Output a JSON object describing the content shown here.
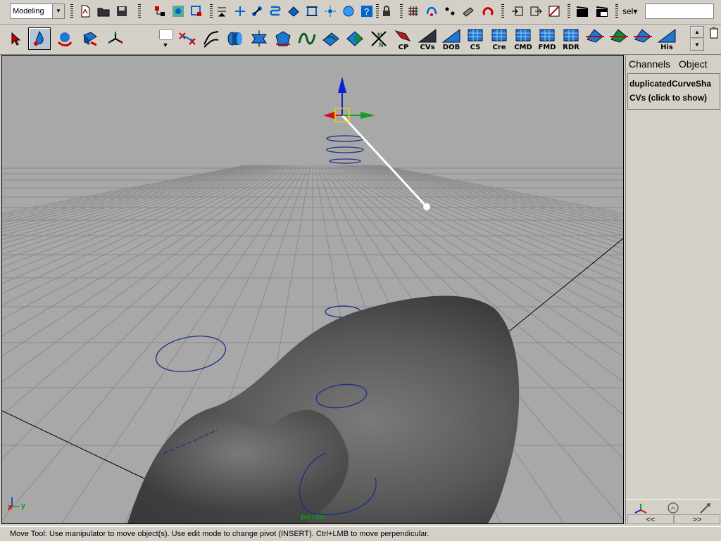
{
  "status_line": {
    "menu_set": "Modeling",
    "selection_label": "sel",
    "selection_input_value": "",
    "icons": [
      "new-scene-icon",
      "open-scene-icon",
      "save-scene-icon",
      "select-by-hierarchy-icon",
      "select-by-object-icon",
      "select-by-component-icon",
      "lock-selection-icon",
      "snap-grid-icon",
      "snap-curve-icon",
      "snap-point-icon",
      "snap-view-plane-icon",
      "snap-live-icon",
      "history-icon",
      "render-icon",
      "ipr-icon"
    ]
  },
  "tool_box": {
    "tools": [
      "select-tool",
      "lasso-move-tool",
      "rotate-tool",
      "scale-tool",
      "manipulator-tool"
    ]
  },
  "shelf": {
    "buttons": [
      {
        "name": "cp",
        "label": "CP"
      },
      {
        "name": "cvs",
        "label": "CVs"
      },
      {
        "name": "dob",
        "label": "DOB"
      },
      {
        "name": "cs",
        "label": "CS"
      },
      {
        "name": "cre",
        "label": "Cre"
      },
      {
        "name": "cmd",
        "label": "CMD"
      },
      {
        "name": "fmd",
        "label": "FMD"
      },
      {
        "name": "rdr",
        "label": "RDR"
      },
      {
        "name": "his",
        "label": "His"
      }
    ]
  },
  "viewport": {
    "camera_label": "persp",
    "axis_x": "x",
    "axis_y": "y"
  },
  "channel_box": {
    "tabs": [
      "Channels",
      "Object"
    ],
    "node_name": "duplicatedCurveSha",
    "cv_hint": "CVs (click to show)",
    "nav_prev": "<<",
    "nav_next": ">>"
  },
  "help_line": {
    "text": "Move Tool: Use manipulator to move object(s). Use edit mode to change pivot (INSERT).  Ctrl+LMB to move perpendicular."
  },
  "colors": {
    "background": "#d4d0c8",
    "viewport_bg": "#a8a8a8",
    "curve_blue": "#1a2f8a",
    "axis_red": "#d41010",
    "axis_green": "#10a020",
    "axis_blue": "#1020d0",
    "camera_label": "#1b8a1b"
  }
}
